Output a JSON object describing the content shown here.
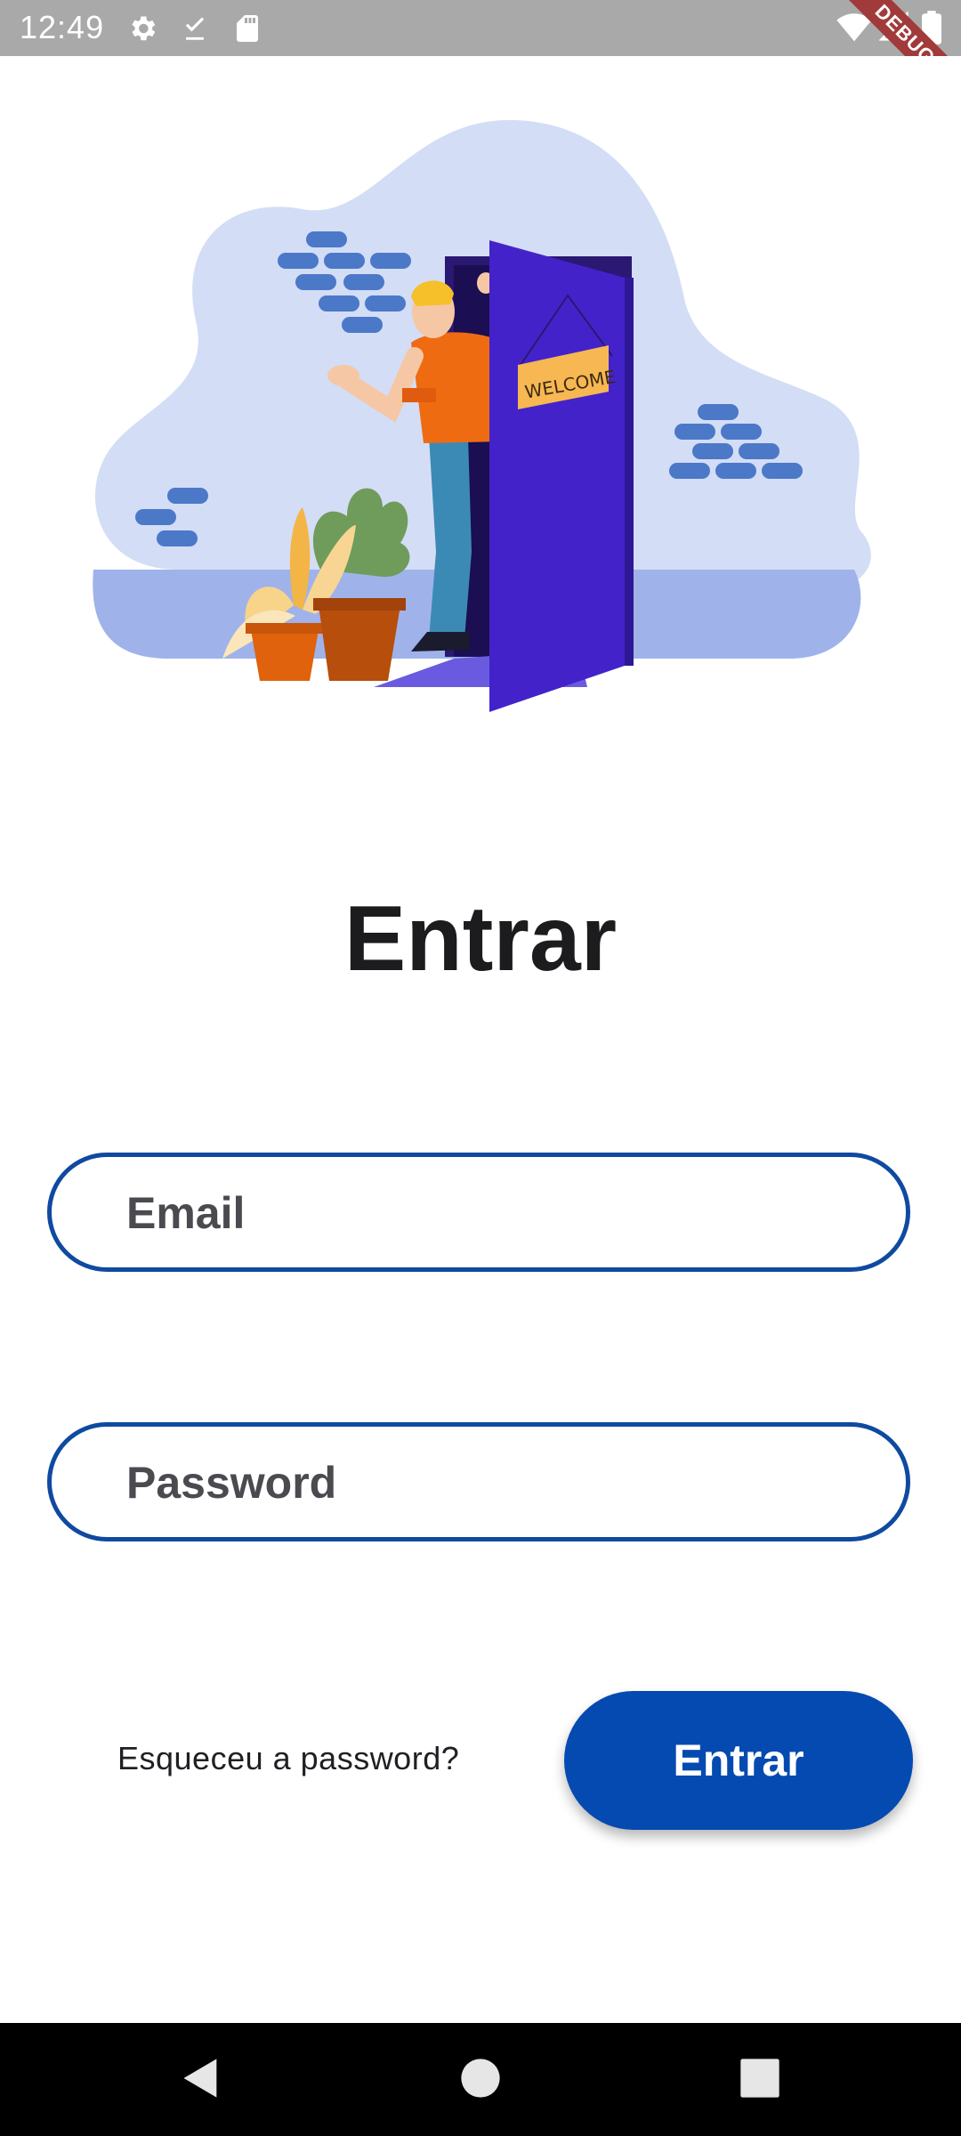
{
  "status_bar": {
    "time": "12:49",
    "left_icons": [
      "gear-icon",
      "download-done-icon",
      "sd-card-icon"
    ],
    "right_icons": [
      "wifi-icon",
      "signal-icon",
      "battery-icon"
    ],
    "debug_label": "DEBUG"
  },
  "illustration": {
    "sign_text": "WELCOME"
  },
  "title": "Entrar",
  "form": {
    "email_placeholder": "Email",
    "password_placeholder": "Password",
    "forgot_label": "Esqueceu a password?",
    "submit_label": "Entrar"
  },
  "nav_bar": {
    "buttons": [
      "back-icon",
      "home-icon",
      "recents-icon"
    ]
  },
  "colors": {
    "primary": "#054ab1",
    "field_border": "#0f4aa0",
    "title": "#1c1c1f"
  }
}
